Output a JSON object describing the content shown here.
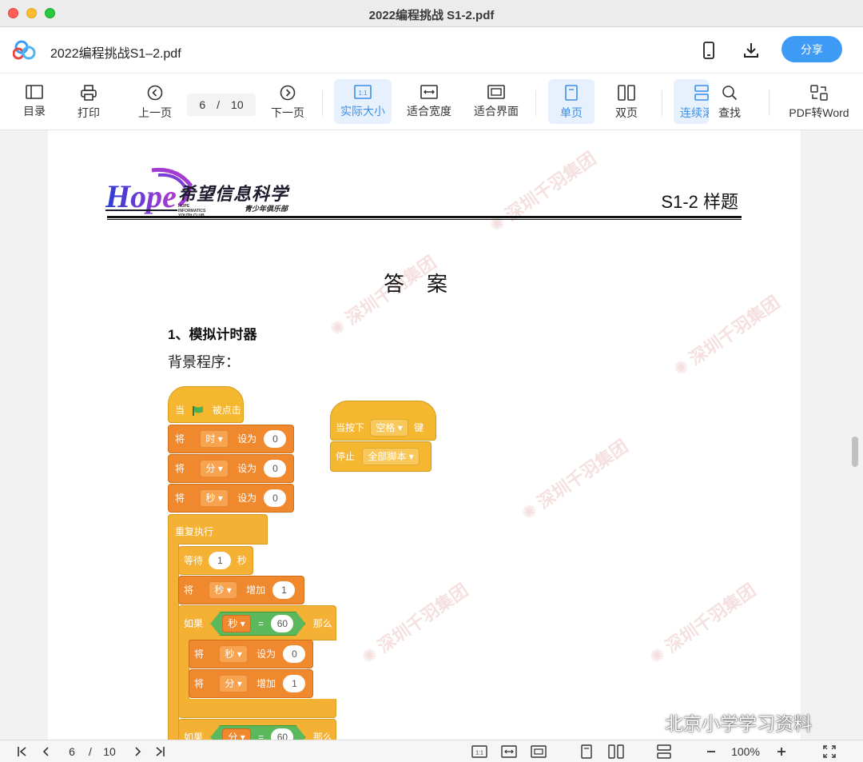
{
  "window": {
    "title": "2022编程挑战 S1-2.pdf"
  },
  "header": {
    "file_name": "2022编程挑战S1–2.pdf",
    "share_label": "分享"
  },
  "toolbar": {
    "toc": "目录",
    "print": "打印",
    "prev": "上一页",
    "page_current": "6",
    "page_sep": "/",
    "page_total": "10",
    "next": "下一页",
    "actual_size": "实际大小",
    "fit_width": "适合宽度",
    "fit_screen": "适合界面",
    "single_page": "单页",
    "double_page": "双页",
    "continuous": "连续滚",
    "find": "查找",
    "pdf_to_word": "PDF转Word"
  },
  "document": {
    "brand_cn": "希望信息科学",
    "brand_en": "HOPE INFORMATICS YOUTH CLUB",
    "brand_club": "青少年俱乐部",
    "sample_title": "S1-2 样题",
    "answer_title": "答案",
    "q1_title": "1、模拟计时器",
    "bg_program": "背景程序："
  },
  "scratch": {
    "when_flag": "当",
    "clicked": "被点击",
    "set": "将",
    "set_to": "设为",
    "hour": "时",
    "minute": "分",
    "second": "秒",
    "zero": "0",
    "forever": "重复执行",
    "wait": "等待",
    "one": "1",
    "sec_unit": "秒",
    "change_by": "增加",
    "if": "如果",
    "equals": "=",
    "sixty": "60",
    "then": "那么",
    "when_key": "当按下",
    "space": "空格",
    "key": "键",
    "stop": "停止",
    "all_scripts": "全部脚本"
  },
  "bottombar": {
    "page_current": "6",
    "page_sep": "/",
    "page_total": "10",
    "zoom": "100%"
  },
  "overlay": {
    "wechat_text": "北京小学学习资料"
  },
  "colors": {
    "accent": "#3d9bf6",
    "active_bg": "#e6f1fd",
    "event_yellow": "#f5b730",
    "variable_orange": "#f0882e",
    "operator_green": "#5cb85c"
  }
}
